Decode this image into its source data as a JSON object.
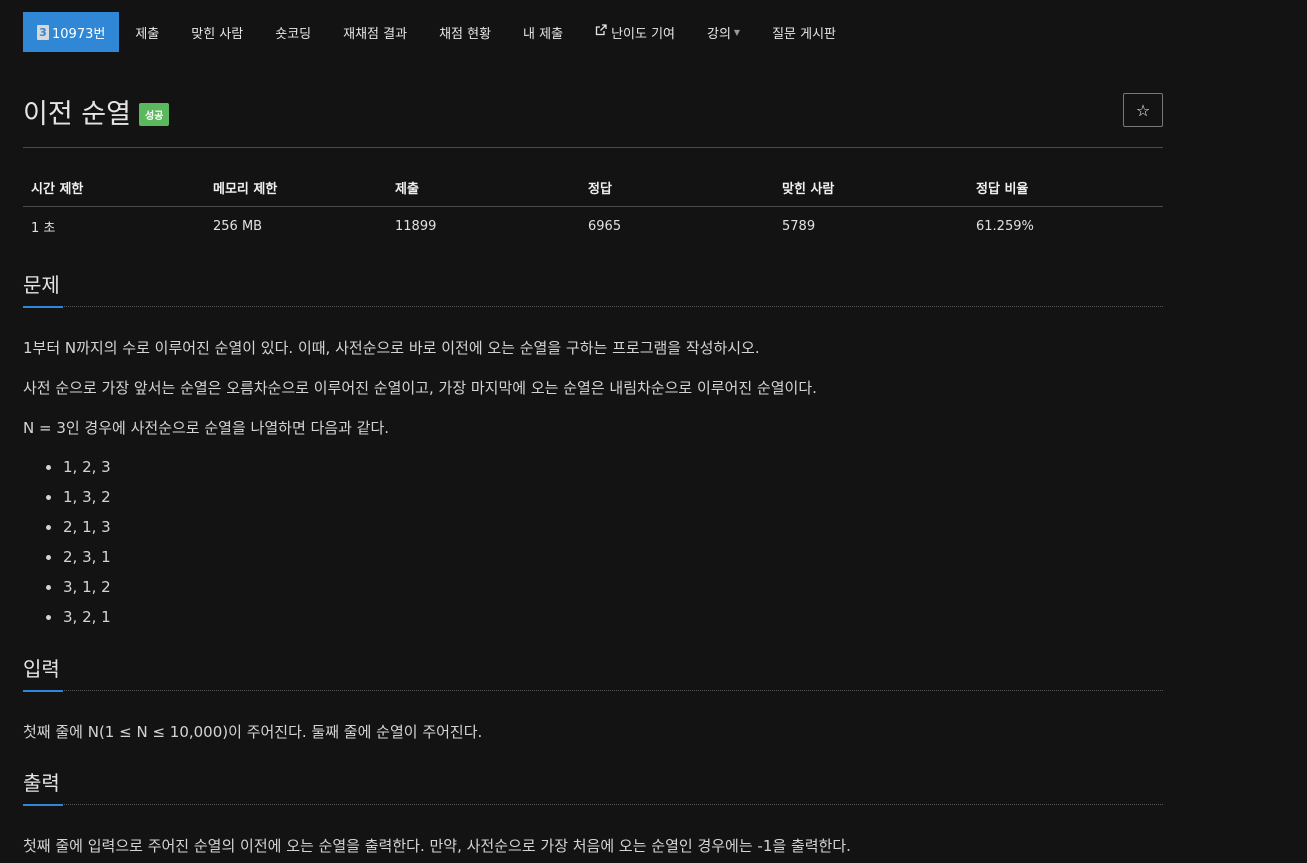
{
  "nav": [
    {
      "label": "10973번",
      "badge": "3",
      "active": true,
      "name": "nav-problem"
    },
    {
      "label": "제출",
      "name": "nav-submit"
    },
    {
      "label": "맞힌 사람",
      "name": "nav-solved-users"
    },
    {
      "label": "숏코딩",
      "name": "nav-short-coding"
    },
    {
      "label": "재채점 결과",
      "name": "nav-rejudge"
    },
    {
      "label": "채점 현황",
      "name": "nav-status"
    },
    {
      "label": "내 제출",
      "name": "nav-my-submissions"
    },
    {
      "label": "난이도 기여",
      "name": "nav-difficulty",
      "ext": true
    },
    {
      "label": "강의",
      "name": "nav-lectures",
      "dropdown": true
    },
    {
      "label": "질문 게시판",
      "name": "nav-board"
    }
  ],
  "title": "이전 순열",
  "badge": "성공",
  "star_icon": "star-icon",
  "info": {
    "headers": [
      "시간 제한",
      "메모리 제한",
      "제출",
      "정답",
      "맞힌 사람",
      "정답 비율"
    ],
    "values": [
      "1 초",
      "256 MB",
      "11899",
      "6965",
      "5789",
      "61.259%"
    ]
  },
  "problem": {
    "heading": "문제",
    "paragraphs": [
      "1부터 N까지의 수로 이루어진 순열이 있다. 이때, 사전순으로 바로 이전에 오는 순열을 구하는 프로그램을 작성하시오.",
      "사전 순으로 가장 앞서는 순열은 오름차순으로 이루어진 순열이고, 가장 마지막에 오는 순열은 내림차순으로 이루어진 순열이다.",
      "N = 3인 경우에 사전순으로 순열을 나열하면 다음과 같다."
    ],
    "list": [
      "1, 2, 3",
      "1, 3, 2",
      "2, 1, 3",
      "2, 3, 1",
      "3, 1, 2",
      "3, 2, 1"
    ]
  },
  "input": {
    "heading": "입력",
    "text": "첫째 줄에 N(1 ≤ N ≤ 10,000)이 주어진다. 둘째 줄에 순열이 주어진다."
  },
  "output": {
    "heading": "출력",
    "text": "첫째 줄에 입력으로 주어진 순열의 이전에 오는 순열을 출력한다. 만약, 사전순으로 가장 처음에 오는 순열인 경우에는 -1을 출력한다."
  }
}
